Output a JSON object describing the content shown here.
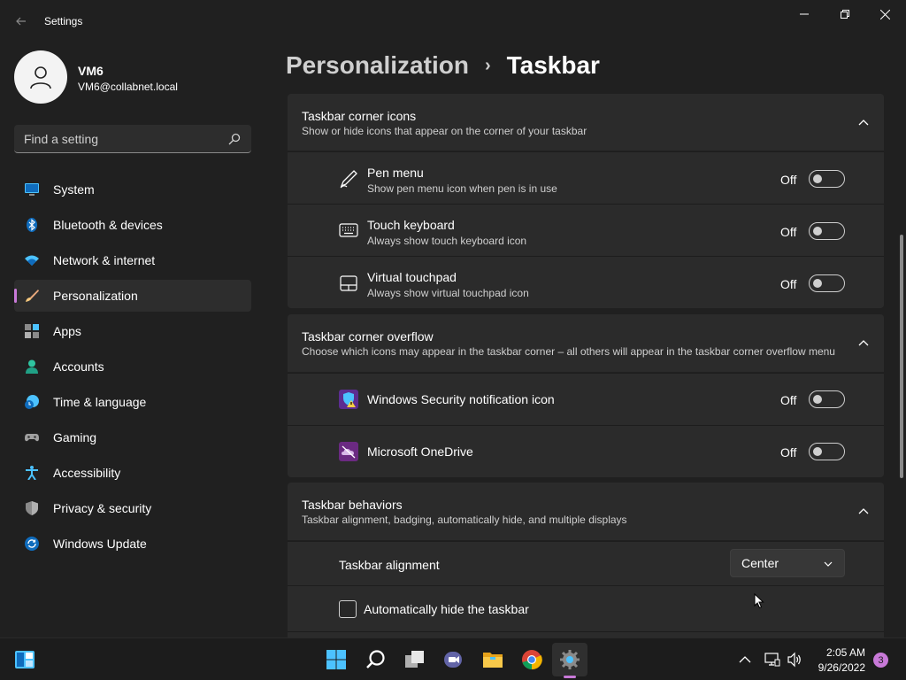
{
  "window": {
    "title": "Settings"
  },
  "profile": {
    "name": "VM6",
    "email": "VM6@collabnet.local"
  },
  "search": {
    "placeholder": "Find a setting"
  },
  "sidebar": {
    "items": [
      {
        "label": "System",
        "icon": "monitor-icon"
      },
      {
        "label": "Bluetooth & devices",
        "icon": "bluetooth-icon"
      },
      {
        "label": "Network & internet",
        "icon": "wifi-icon"
      },
      {
        "label": "Personalization",
        "icon": "brush-icon",
        "selected": true
      },
      {
        "label": "Apps",
        "icon": "apps-icon"
      },
      {
        "label": "Accounts",
        "icon": "person-icon"
      },
      {
        "label": "Time & language",
        "icon": "clock-globe-icon"
      },
      {
        "label": "Gaming",
        "icon": "gamepad-icon"
      },
      {
        "label": "Accessibility",
        "icon": "accessibility-icon"
      },
      {
        "label": "Privacy & security",
        "icon": "shield-icon"
      },
      {
        "label": "Windows Update",
        "icon": "update-icon"
      }
    ]
  },
  "header": {
    "parent": "Personalization",
    "separator": "›",
    "current": "Taskbar"
  },
  "sections": {
    "corner_icons": {
      "title": "Taskbar corner icons",
      "description": "Show or hide icons that appear on the corner of your taskbar",
      "rows": [
        {
          "title": "Pen menu",
          "description": "Show pen menu icon when pen is in use",
          "state": "Off",
          "icon": "pen-icon"
        },
        {
          "title": "Touch keyboard",
          "description": "Always show touch keyboard icon",
          "state": "Off",
          "icon": "keyboard-icon"
        },
        {
          "title": "Virtual touchpad",
          "description": "Always show virtual touchpad icon",
          "state": "Off",
          "icon": "touchpad-icon"
        }
      ]
    },
    "corner_overflow": {
      "title": "Taskbar corner overflow",
      "description": "Choose which icons may appear in the taskbar corner – all others will appear in the taskbar corner overflow menu",
      "rows": [
        {
          "title": "Windows Security notification icon",
          "state": "Off",
          "icon": "windows-security-icon"
        },
        {
          "title": "Microsoft OneDrive",
          "state": "Off",
          "icon": "onedrive-icon"
        }
      ]
    },
    "behaviors": {
      "title": "Taskbar behaviors",
      "description": "Taskbar alignment, badging, automatically hide, and multiple displays",
      "alignment_label": "Taskbar alignment",
      "alignment_value": "Center",
      "autohide_label": "Automatically hide the taskbar"
    }
  },
  "taskbar": {
    "time": "2:05 AM",
    "date": "9/26/2022",
    "notification_count": "3"
  },
  "colors": {
    "accent": "#c879d8",
    "background": "#202020",
    "card": "#2b2b2b"
  }
}
